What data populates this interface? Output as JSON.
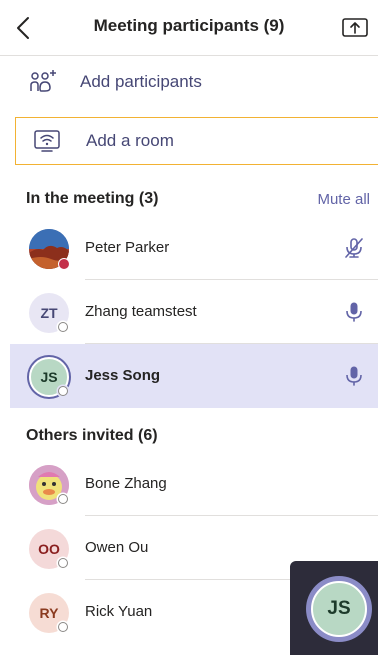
{
  "header": {
    "title": "Meeting participants (9)",
    "back_icon": "chevron-left-icon",
    "share_icon": "share-screen-icon"
  },
  "actions": {
    "add_participants": "Add participants",
    "add_room": "Add a room"
  },
  "in_meeting": {
    "heading": "In the meeting (3)",
    "mute_all": "Mute all",
    "people": [
      {
        "name": "Peter Parker",
        "initials": "",
        "status": "busy",
        "mic": "muted"
      },
      {
        "name": "Zhang teamstest",
        "initials": "ZT",
        "status": "offline",
        "mic": "on"
      },
      {
        "name": "Jess Song",
        "initials": "JS",
        "status": "offline",
        "mic": "on",
        "selected": true
      }
    ]
  },
  "others_invited": {
    "heading": "Others invited (6)",
    "people": [
      {
        "name": "Bone Zhang",
        "initials": "",
        "status": "offline"
      },
      {
        "name": "Owen Ou",
        "initials": "OO",
        "status": "offline"
      },
      {
        "name": "Rick Yuan",
        "initials": "RY",
        "status": "offline"
      }
    ]
  },
  "self_view": {
    "initials": "JS"
  },
  "colors": {
    "accent": "#6264a7",
    "busy": "#c4314b",
    "room_border": "#f2b233",
    "selected_bg": "#e2e2f6"
  }
}
